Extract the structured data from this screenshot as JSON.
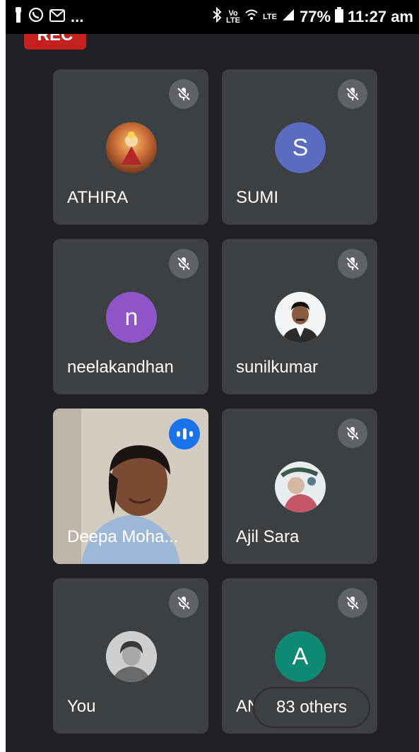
{
  "status_bar": {
    "left_dots": "...",
    "volte_label": "Vo\nLTE",
    "lte_label": "LTE",
    "battery": "77%",
    "time": "11:27 am"
  },
  "rec_label": "REC",
  "participants": [
    {
      "name": "ATHIRA",
      "muted": true,
      "avatar_type": "photo"
    },
    {
      "name": "SUMI",
      "muted": true,
      "avatar_type": "letter",
      "letter": "S",
      "color": "#5c6bc0"
    },
    {
      "name": "neelakandhan",
      "muted": true,
      "avatar_type": "letter",
      "letter": "n",
      "color": "#8e55c9"
    },
    {
      "name": "sunilkumar",
      "muted": true,
      "avatar_type": "photo"
    },
    {
      "name": "Deepa Moha...",
      "muted": false,
      "speaking": true,
      "avatar_type": "video"
    },
    {
      "name": "Ajil Sara",
      "muted": true,
      "avatar_type": "photo"
    },
    {
      "name": "You",
      "muted": true,
      "avatar_type": "photo"
    },
    {
      "name": "AN",
      "muted": true,
      "avatar_type": "letter",
      "letter": "A",
      "color": "#0f8a72"
    }
  ],
  "others_label": "83 others",
  "colors": {
    "background": "#202124",
    "tile": "#3c4043",
    "mute_button": "#5f6368",
    "speaking_indicator": "#1a73e8",
    "rec": "#c5221f"
  }
}
